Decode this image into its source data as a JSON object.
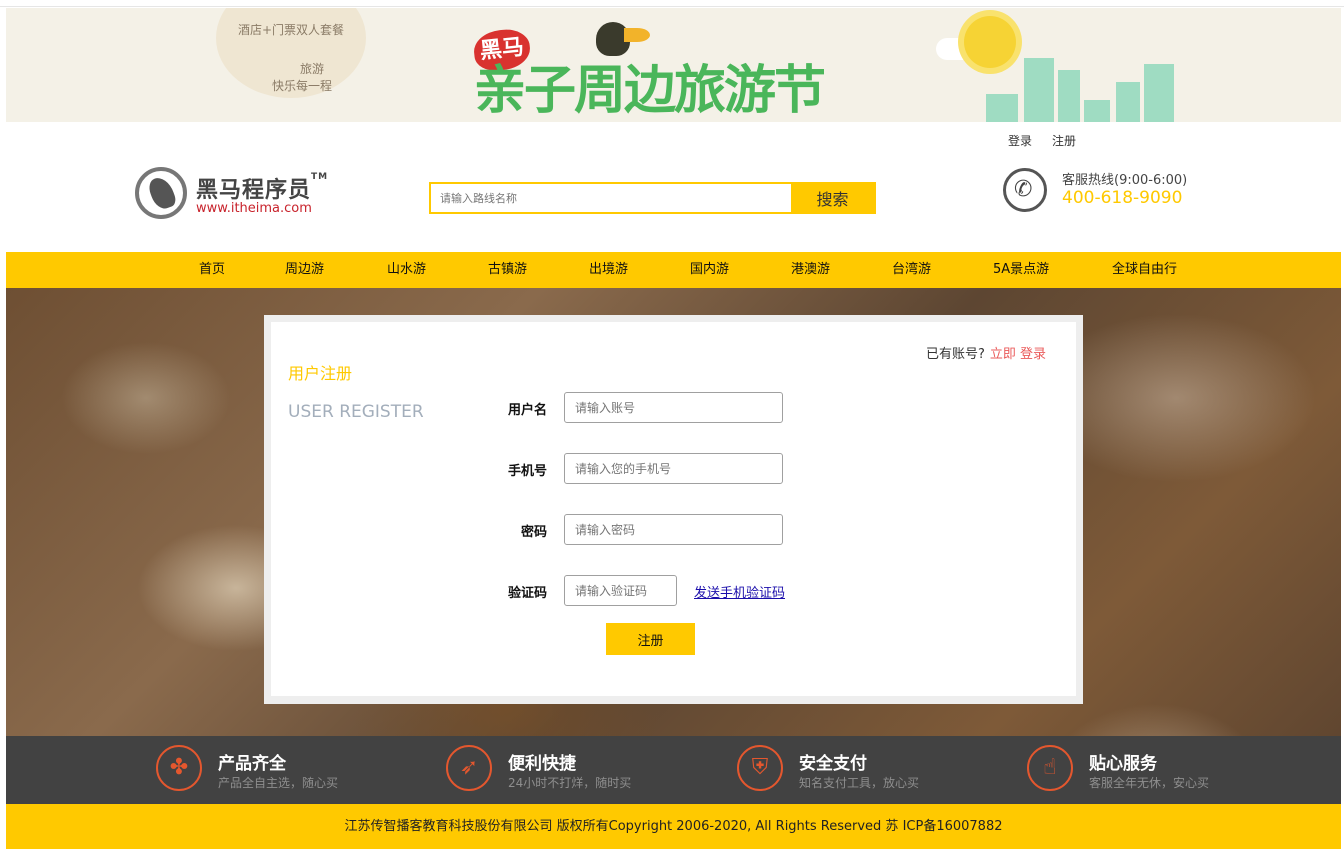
{
  "banner": {
    "promo_line1": "酒店+门票双人套餐",
    "promo_line2": "旅游",
    "promo_line3": "快乐每一程",
    "badge": "黑马",
    "festival_title": "亲子周边旅游节"
  },
  "header": {
    "login": "登录",
    "register": "注册",
    "logo_text": "黑马程序员",
    "logo_tm": "TM",
    "logo_url": "www.itheima.com",
    "search_placeholder": "请输入路线名称",
    "search_button": "搜索",
    "hotline_label": "客服热线(9:00-6:00)",
    "hotline_number": "400-618-9090"
  },
  "nav": [
    "首页",
    "周边游",
    "山水游",
    "古镇游",
    "出境游",
    "国内游",
    "港澳游",
    "台湾游",
    "5A景点游",
    "全球自由行"
  ],
  "register": {
    "title_cn": "用户注册",
    "title_en": "USER REGISTER",
    "has_account": "已有账号?",
    "login_now": "立即 登录",
    "username_label": "用户名",
    "username_placeholder": "请输入账号",
    "phone_label": "手机号",
    "phone_placeholder": "请输入您的手机号",
    "password_label": "密码",
    "password_placeholder": "请输入密码",
    "code_label": "验证码",
    "code_placeholder": "请输入验证码",
    "send_code": "发送手机验证码",
    "submit": "注册"
  },
  "features": [
    {
      "icon": "clover-icon",
      "title": "产品齐全",
      "desc": "产品全自主选，随心买"
    },
    {
      "icon": "rocket-icon",
      "title": "便利快捷",
      "desc": "24小时不打烊，随时买"
    },
    {
      "icon": "shield-icon",
      "title": "安全支付",
      "desc": "知名支付工具，放心买"
    },
    {
      "icon": "thumbs-up-icon",
      "title": "贴心服务",
      "desc": "客服全年无休，安心买"
    }
  ],
  "footer": "江苏传智播客教育科技股份有限公司 版权所有Copyright 2006-2020, All Rights Reserved 苏 ICP备16007882",
  "colors": {
    "accent": "#ffc900",
    "feature_icon": "#e4572e",
    "feature_bar": "#424242"
  }
}
